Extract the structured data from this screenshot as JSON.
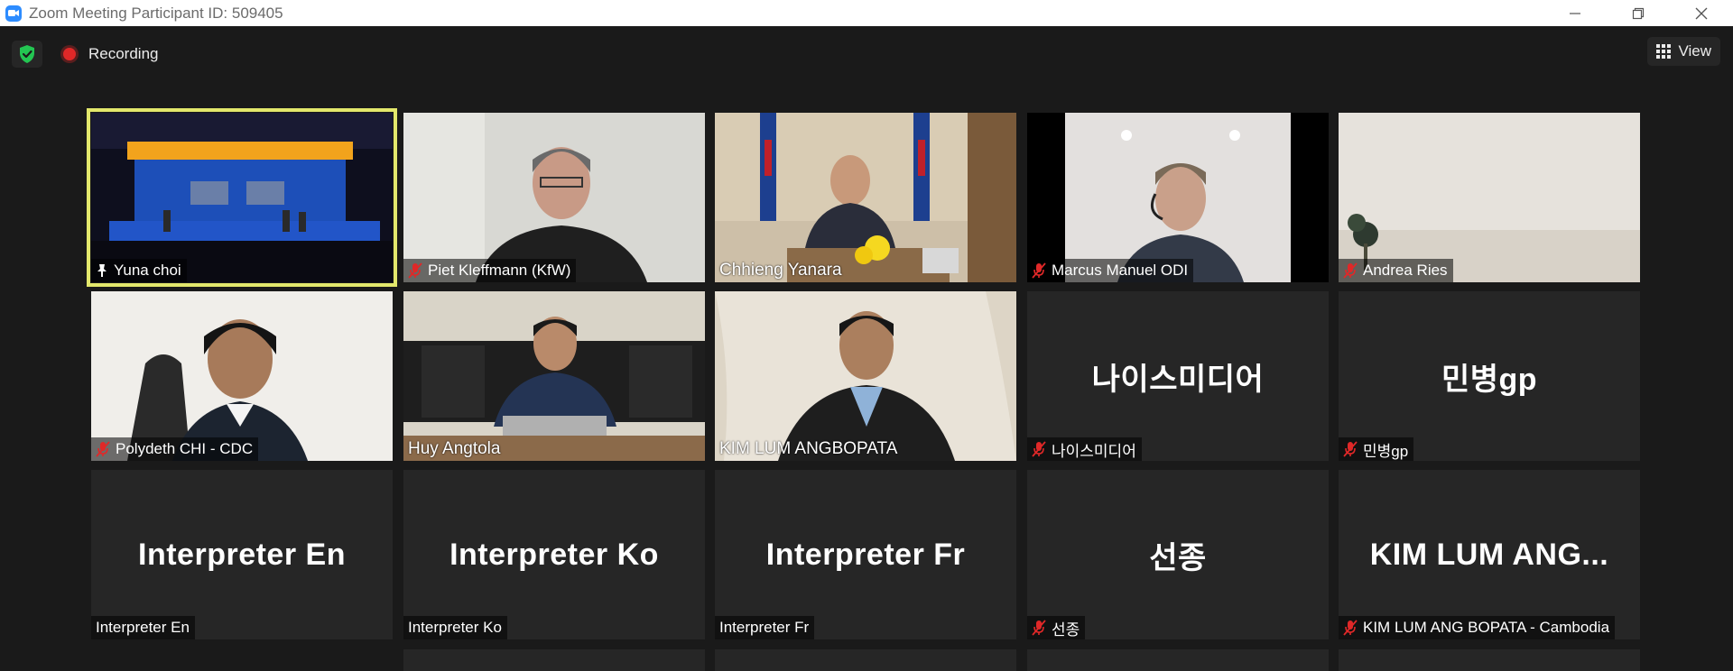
{
  "window": {
    "title": "Zoom Meeting Participant ID: 509405",
    "minimize_icon": "minimize-icon",
    "restore_icon": "restore-icon",
    "close_icon": "close-icon"
  },
  "toolbar": {
    "security_icon": "shield-check-icon",
    "recording_label": "Recording",
    "view_label": "View"
  },
  "colors": {
    "active_speaker": "#e3e86c",
    "recording": "#e02828",
    "shield": "#23c552",
    "mute": "#e02828",
    "background": "#1a1a1a",
    "tile": "#262626"
  },
  "participants": [
    {
      "name": "Yuna choi",
      "muted": false,
      "pinned": true,
      "active": true
    },
    {
      "name": "Piet Kleffmann (KfW)",
      "muted": true
    },
    {
      "name": "Chhieng Yanara",
      "muted": false
    },
    {
      "name": "Marcus Manuel ODI",
      "muted": true
    },
    {
      "name": "Andrea Ries",
      "muted": true
    },
    {
      "name": "Polydeth CHI - CDC",
      "muted": true
    },
    {
      "name": "Huy Angtola",
      "muted": false
    },
    {
      "name": "KIM LUM ANGBOPATA",
      "muted": false
    },
    {
      "name": "나이스미디어",
      "display": "나이스미디어",
      "muted": true
    },
    {
      "name": "민병gp",
      "display": "민병gp",
      "muted": true
    },
    {
      "name": "Interpreter En",
      "display": "Interpreter En",
      "muted": false
    },
    {
      "name": "Interpreter Ko",
      "display": "Interpreter Ko",
      "muted": false
    },
    {
      "name": "Interpreter Fr",
      "display": "Interpreter Fr",
      "muted": false
    },
    {
      "name": "선종",
      "display": "선종",
      "muted": true
    },
    {
      "name": "KIM LUM ANG BOPATA - Cambodia",
      "display": "KIM LUM ANG...",
      "muted": true
    }
  ]
}
